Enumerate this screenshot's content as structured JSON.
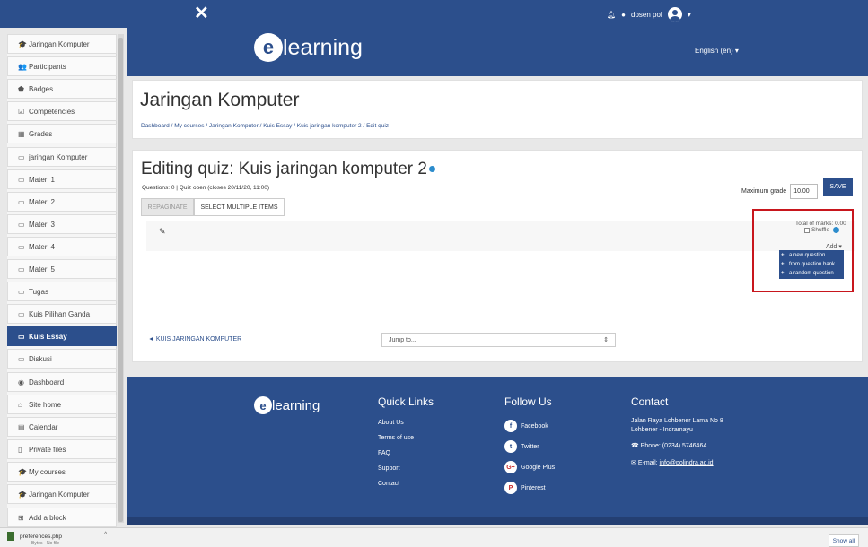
{
  "topbar": {
    "close_icon": "✕",
    "user": "dosen pol",
    "caret": "▾"
  },
  "banner": {
    "logo_letter": "e",
    "logo_word": "learning",
    "language": "English (en) ▾"
  },
  "sidebar": {
    "items": [
      {
        "icon": "graduation-cap",
        "glyph": "🎓",
        "label": "Jaringan Komputer"
      },
      {
        "icon": "users",
        "glyph": "👥",
        "label": "Participants"
      },
      {
        "icon": "shield",
        "glyph": "⬟",
        "label": "Badges"
      },
      {
        "icon": "check-square",
        "glyph": "☑",
        "label": "Competencies"
      },
      {
        "icon": "table",
        "glyph": "▦",
        "label": "Grades"
      },
      {
        "icon": "folder",
        "glyph": "▭",
        "label": "jaringan Komputer"
      },
      {
        "icon": "folder",
        "glyph": "▭",
        "label": "Materi 1"
      },
      {
        "icon": "folder",
        "glyph": "▭",
        "label": "Materi 2"
      },
      {
        "icon": "folder",
        "glyph": "▭",
        "label": "Materi 3"
      },
      {
        "icon": "folder",
        "glyph": "▭",
        "label": "Materi 4"
      },
      {
        "icon": "folder",
        "glyph": "▭",
        "label": "Materi 5"
      },
      {
        "icon": "folder",
        "glyph": "▭",
        "label": "Tugas"
      },
      {
        "icon": "folder",
        "glyph": "▭",
        "label": "Kuis Pilihan Ganda"
      },
      {
        "icon": "folder",
        "glyph": "▭",
        "label": "Kuis Essay"
      },
      {
        "icon": "folder",
        "glyph": "▭",
        "label": "Diskusi"
      },
      {
        "icon": "dashboard",
        "glyph": "◉",
        "label": "Dashboard"
      },
      {
        "icon": "home",
        "glyph": "⌂",
        "label": "Site home"
      },
      {
        "icon": "calendar",
        "glyph": "▤",
        "label": "Calendar"
      },
      {
        "icon": "file",
        "glyph": "▯",
        "label": "Private files"
      },
      {
        "icon": "graduation-cap",
        "glyph": "🎓",
        "label": "My courses"
      },
      {
        "icon": "graduation-cap",
        "glyph": "🎓",
        "label": "Jaringan Komputer"
      },
      {
        "icon": "plus-square",
        "glyph": "⊞",
        "label": "Add a block"
      }
    ]
  },
  "course": {
    "title": "Jaringan Komputer",
    "breadcrumb": "Dashboard / My courses / Jaringan Komputer / Kuis Essay / Kuis jaringan komputer 2 / Edit quiz"
  },
  "quiz": {
    "title": "Editing quiz: Kuis jaringan komputer 2",
    "info": "Questions: 0 | Quiz open (closes 20/11/20, 11:00)",
    "max_grade_label": "Maximum grade",
    "max_grade_value": "10.00",
    "save_label": "SAVE",
    "repaginate_label": "REPAGINATE",
    "select_multiple_label": "SELECT MULTIPLE ITEMS",
    "total_marks": "Total of marks: 0.00",
    "shuffle_label": "Shuffle",
    "add_label": "Add ▾",
    "add_menu": [
      "a new question",
      "from question bank",
      "a random question"
    ],
    "prev_link": "◄ KUIS JARINGAN KOMPUTER",
    "jump_placeholder": "Jump to...",
    "jump_caret": "⇕"
  },
  "footer": {
    "logo_letter": "e",
    "logo_word": "learning",
    "quick_links_title": "Quick Links",
    "quick_links": [
      "About Us",
      "Terms of use",
      "FAQ",
      "Support",
      "Contact"
    ],
    "follow_title": "Follow Us",
    "social": [
      {
        "name": "Facebook",
        "glyph": "f"
      },
      {
        "name": "Twitter",
        "glyph": "t"
      },
      {
        "name": "Google Plus",
        "glyph": "G+"
      },
      {
        "name": "Pinterest",
        "glyph": "P"
      }
    ],
    "contact_title": "Contact",
    "address_line1": "Jalan Raya Lohbener Lama No 8",
    "address_line2": "Lohbener - Indramayu",
    "phone": "Phone: (0234) 5746464",
    "email_label": "E-mail:",
    "email": "info@polindra.ac.id"
  },
  "downloads": {
    "file_name": "preferences.php",
    "file_sub": "Bytes - No file",
    "show_all": "Show all",
    "caret": "^"
  }
}
